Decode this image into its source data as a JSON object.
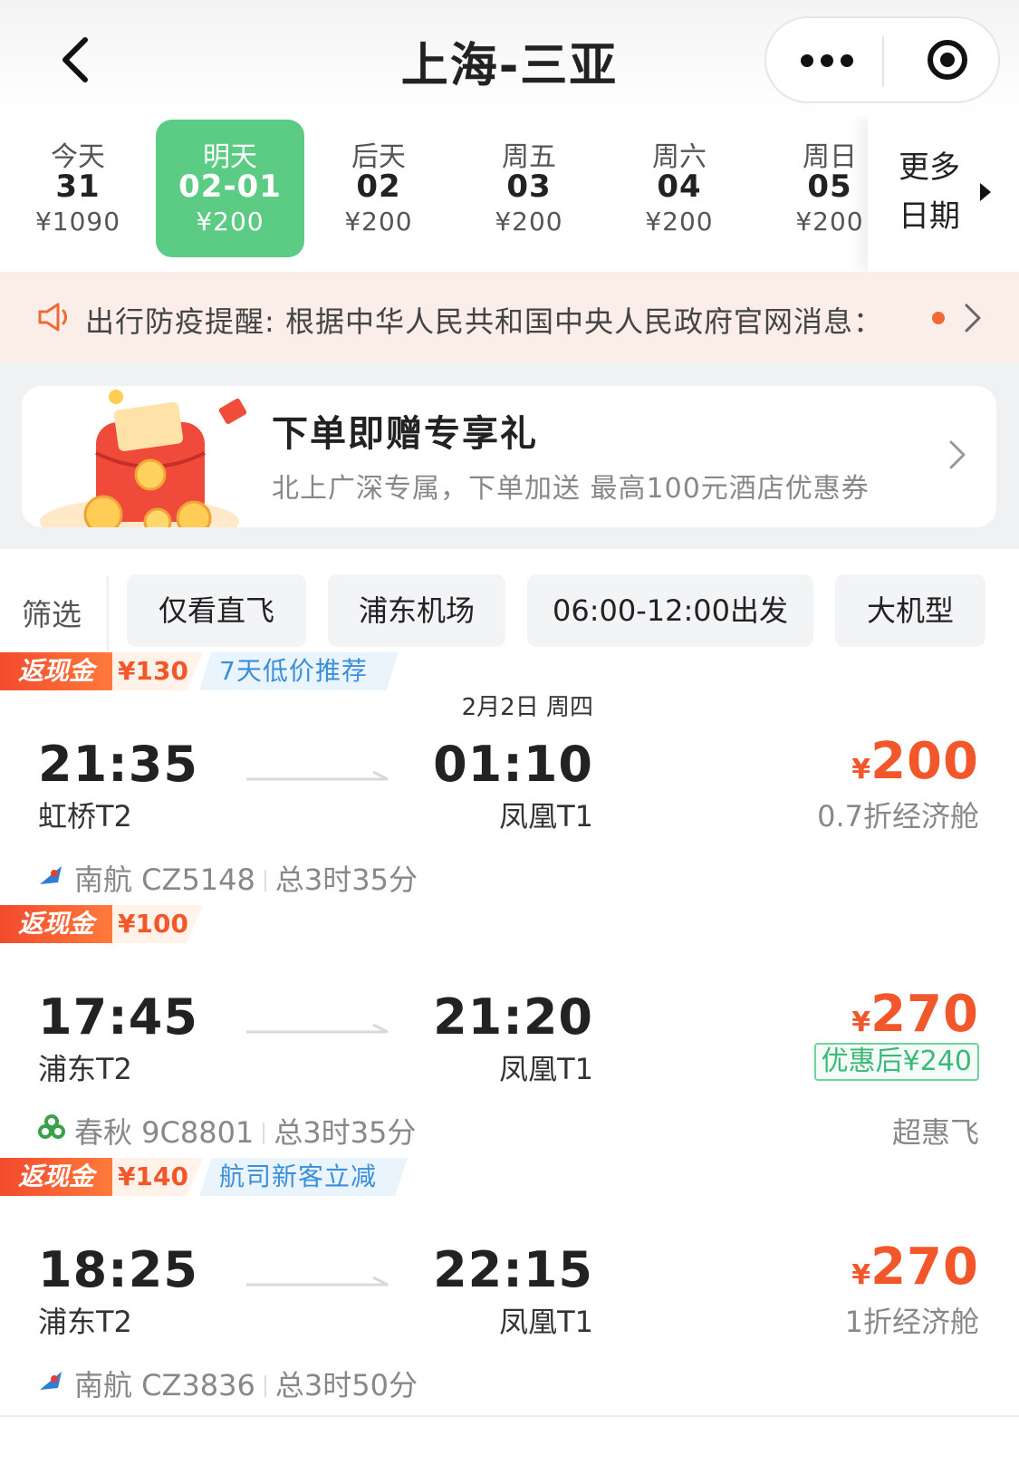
{
  "header": {
    "title": "上海-三亚"
  },
  "dates": [
    {
      "label": "今天",
      "date": "31",
      "price": "¥1090",
      "selected": false
    },
    {
      "label": "明天",
      "date": "02-01",
      "price": "¥200",
      "selected": true
    },
    {
      "label": "后天",
      "date": "02",
      "price": "¥200",
      "selected": false
    },
    {
      "label": "周五",
      "date": "03",
      "price": "¥200",
      "selected": false
    },
    {
      "label": "周六",
      "date": "04",
      "price": "¥200",
      "selected": false
    },
    {
      "label": "周日",
      "date": "05",
      "price": "¥200",
      "selected": false
    }
  ],
  "more_dates": {
    "label": "更多日期"
  },
  "notice": {
    "text": "出行防疫提醒: 根据中华人民共和国中央人民政府官网消息："
  },
  "promo": {
    "title": "下单即赠专享礼",
    "subtitle": "北上广深专属，下单加送 最高100元酒店优惠券"
  },
  "filters": {
    "label": "筛选",
    "chips": [
      "仅看直飞",
      "浦东机场",
      "06:00-12:00出发",
      "大机型"
    ]
  },
  "flights": [
    {
      "cashback_label": "返现金",
      "cashback_amount": "¥130",
      "promo_tag": "7天低价推荐",
      "dep_time": "21:35",
      "dep_airport": "虹桥T2",
      "arr_date": "2月2日 周四",
      "arr_time": "01:10",
      "arr_airport": "凤凰T1",
      "currency": "¥",
      "price": "200",
      "cabin": "0.7折经济舱",
      "discount_badge": "",
      "airline": "南航 CZ5148",
      "duration": "总3时35分",
      "right_note": "",
      "airline_icon": "china-southern-icon"
    },
    {
      "cashback_label": "返现金",
      "cashback_amount": "¥100",
      "promo_tag": "",
      "dep_time": "17:45",
      "dep_airport": "浦东T2",
      "arr_date": "",
      "arr_time": "21:20",
      "arr_airport": "凤凰T1",
      "currency": "¥",
      "price": "270",
      "cabin": "",
      "discount_badge": "优惠后¥240",
      "airline": "春秋 9C8801",
      "duration": "总3时35分",
      "right_note": "超惠飞",
      "airline_icon": "spring-airlines-icon"
    },
    {
      "cashback_label": "返现金",
      "cashback_amount": "¥140",
      "promo_tag": "航司新客立减",
      "dep_time": "18:25",
      "dep_airport": "浦东T2",
      "arr_date": "",
      "arr_time": "22:15",
      "arr_airport": "凤凰T1",
      "currency": "¥",
      "price": "270",
      "cabin": "1折经济舱",
      "discount_badge": "",
      "airline": "南航 CZ3836",
      "duration": "总3时50分",
      "right_note": "",
      "airline_icon": "china-southern-icon"
    }
  ],
  "colors": {
    "accent_green": "#5ccc84",
    "price_orange": "#f2572c",
    "tag_blue": "#3b8fd9",
    "notice_bg": "#fbeee9"
  }
}
